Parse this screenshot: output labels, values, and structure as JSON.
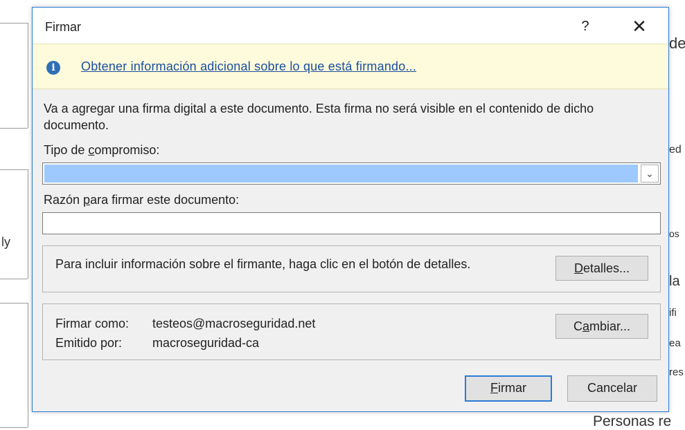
{
  "background": {
    "fragments": [
      "de",
      "ed",
      "ly",
      "os",
      "la",
      "ifi",
      "ea",
      "res",
      "Personas re"
    ]
  },
  "dialog": {
    "title": "Firmar",
    "help_label": "?",
    "close_label": "✕",
    "info": {
      "icon": "info-icon",
      "icon_glyph": "i",
      "link_text": "Obtener información adicional sobre lo que está firmando..."
    },
    "description": "Va a agregar una firma digital a este documento. Esta firma no será visible en el contenido de dicho documento.",
    "commitment": {
      "label_pre": "Tipo de ",
      "label_ul": "c",
      "label_post": "ompromiso:",
      "value": ""
    },
    "reason": {
      "label_pre": "Razón ",
      "label_ul": "p",
      "label_post": "ara firmar este documento:",
      "value": ""
    },
    "details_group": {
      "text": "Para incluir información sobre el firmante, haga clic en el botón de detalles.",
      "button_ul": "D",
      "button_rest": "etalles..."
    },
    "signer_group": {
      "sign_as_label": "Firmar como:",
      "sign_as_value": "testeos@macroseguridad.net",
      "issued_by_label": "Emitido por:",
      "issued_by_value": "macroseguridad-ca",
      "change_pre": "C",
      "change_ul": "a",
      "change_rest": "mbiar..."
    },
    "buttons": {
      "sign_ul": "F",
      "sign_rest": "irmar",
      "cancel": "Cancelar"
    },
    "colors": {
      "accent": "#2b7bd6",
      "infobar": "#fdfbdb",
      "selection": "#9ec9ff",
      "link": "#1a4ea0"
    }
  }
}
